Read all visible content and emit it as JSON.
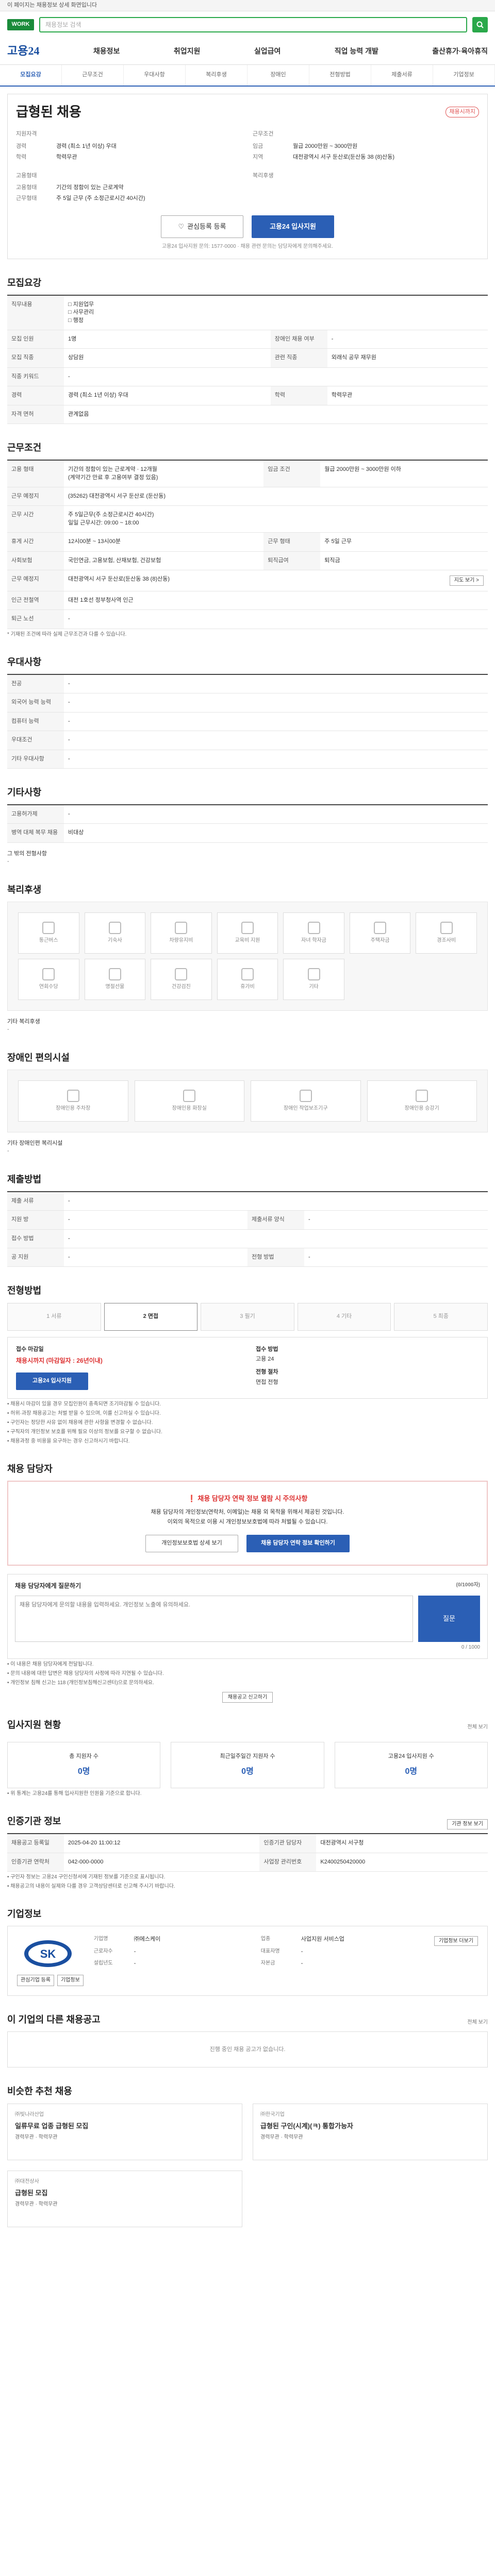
{
  "banner": {
    "text": "이 페이지는 채용정보 상세 화면입니다"
  },
  "search": {
    "placeholder": "채용정보 검색"
  },
  "gnb": {
    "brand": "고용24",
    "items": [
      "채용정보",
      "취업지원",
      "실업급여",
      "직업 능력 개발",
      "출산휴가·육아휴직"
    ]
  },
  "tabs": [
    "모집요강",
    "근무조건",
    "우대사항",
    "복리후생",
    "장애인",
    "전형방법",
    "제출서류",
    "기업정보"
  ],
  "job": {
    "badge": "채용시까지",
    "title": "급형된 채용",
    "left_heading": "지원자격",
    "left": [
      {
        "k": "경력",
        "v": "경력 (최소 1년 이상) 우대"
      },
      {
        "k": "학력",
        "v": "학력무관"
      }
    ],
    "right_heading": "근무조건",
    "right": [
      {
        "k": "임금",
        "v": "월급 2000만원 ~ 3000만원"
      },
      {
        "k": "지역",
        "v": "대전광역시 서구 둔산로(둔산동 38 (8)산동)"
      }
    ],
    "left2_heading": "고용형태",
    "left2": [
      {
        "k": "고용형태",
        "v": "기간의 정함이 있는 근로계약"
      },
      {
        "k": "근무형태",
        "v": "주 5일 근무 (주 소정근로시간 40시간)"
      }
    ],
    "right2_heading": "복리후생",
    "apply_buttons": {
      "bookmark": "관심등록 등록",
      "apply": "고용24 입사지원"
    },
    "note": "고용24 입사지원 문의: 1577-0000 · 채용 관련 문의는 담당자에게 문의해주세요."
  },
  "recruit": {
    "title": "모집요강",
    "rows": [
      {
        "k": "직무내용",
        "v": "□ 지원업무\n□ 사무관리\n□ 행정"
      },
      {
        "k": "모집 인원",
        "v": "1명"
      },
      {
        "k": "모집 직종",
        "v": "상담원"
      },
      {
        "k": "직종 키워드",
        "v": "-"
      },
      {
        "k": "경력",
        "v": "경력 (최소 1년 이상) 우대"
      },
      {
        "k": "자격 면허",
        "v": "관계없음"
      }
    ],
    "rows_right": [
      {
        "k": "장애인 채용 여부",
        "v": "-"
      },
      {
        "k": "관련 직종",
        "v": "외래식 공무 재무원"
      },
      {
        "k": "학력",
        "v": "학력무관"
      }
    ]
  },
  "conditions": {
    "title": "근무조건",
    "rows": [
      {
        "k": "고용 형태",
        "v": "기간의 정함이 있는 근로계약 · 12개월\n(계약기간 만료 후 고용여부 결정 있음)"
      },
      {
        "k": "근무 예정지",
        "v": "(35262) 대전광역시 서구 둔산로 (둔산동)"
      },
      {
        "k": "근무 시간",
        "v": "주 5일근무(주 소정근로시간 40시간)\n일일 근무시간: 09:00 ~ 18:00"
      },
      {
        "k": "휴게 시간",
        "v": "12시00분 ~ 13시00분"
      },
      {
        "k": "사회보험",
        "v": "국민연금, 고용보험, 산재보험, 건강보험"
      },
      {
        "k": "근무 예정지",
        "v": "대전광역시 서구 둔산로(둔산동 38 (8)산동)"
      },
      {
        "k": "인근 전철역",
        "v": "대전 1호선 정부청사역 인근"
      },
      {
        "k": "퇴근 노선",
        "v": "-"
      }
    ],
    "right": [
      {
        "k": "임금 조건",
        "v": "월급 2000만원 ~ 3000만원 이하"
      },
      {
        "k": "근무 형태",
        "v": "주 5일 근무"
      },
      {
        "k": "퇴직급여",
        "v": "퇴직금"
      }
    ],
    "map_btn": "지도 보기 >",
    "footnote": "* 기재된 조건에 따라 실제 근무조건과 다를 수 있습니다."
  },
  "preference": {
    "title": "우대사항",
    "rows": [
      {
        "k": "전공",
        "v": "-"
      },
      {
        "k": "외국어 능력 능력",
        "v": "-"
      },
      {
        "k": "컴퓨터 능력",
        "v": "-"
      },
      {
        "k": "우대조건",
        "v": "-"
      },
      {
        "k": "기타 우대사항",
        "v": "-"
      }
    ]
  },
  "etc": {
    "title": "기타사항",
    "rows": [
      {
        "k": "고용허가제",
        "v": "-"
      },
      {
        "k": "병역 대체 복무 채용",
        "v": "비대상"
      }
    ],
    "extra_k": "그 밖의 전형사항",
    "extra_v": "-"
  },
  "welfare": {
    "title": "복리후생",
    "items": [
      "통근버스",
      "기숙사",
      "차량유지비",
      "교육비 지원",
      "자녀 학자금",
      "주택자금",
      "경조사비",
      "연회수당",
      "명절선물",
      "건강검진",
      "휴가비",
      "기타"
    ],
    "extra_k": "기타 복리후생",
    "extra_v": "-"
  },
  "disabled": {
    "title": "장애인 편의시설",
    "items": [
      "장애인용 주차장",
      "장애인용 화장실",
      "장애인 작업보조기구",
      "장애인용 승강기"
    ],
    "extra_k": "기타 장애인편 복리시설",
    "extra_v": "-"
  },
  "apply_info": {
    "title": "제출방법",
    "rows": [
      {
        "k": "제출 서류",
        "v": "-"
      },
      {
        "k": "지원 방",
        "v": "-"
      },
      {
        "k": "접수 방법",
        "v": "-"
      },
      {
        "k": "공 지원",
        "v": "-"
      }
    ],
    "right": [
      {
        "k": "제출서류 양식",
        "v": "-"
      },
      {
        "k": "전형 방법",
        "v": "-"
      }
    ]
  },
  "process": {
    "title": "전형방법",
    "steps": [
      "1 서류",
      "2 면접",
      "3 필기",
      "4 기타",
      "5 최종"
    ],
    "active": 1,
    "deadline_label": "접수 마감일",
    "deadline": "채용시까지 (마감일자 : 26년이내)",
    "apply_label": "고용24 입사지원",
    "method_label": "접수 방법",
    "method": "고용 24",
    "stage_label": "전형 절차",
    "stage": "면접 전형",
    "notes": [
      "• 채용시 마감이 있을 경우 모집인원이 충족되면 조기마감될 수 있습니다.",
      "• 허위·과장 채용공고는 처벌 받을 수 있으며, 이를 신고하실 수 있습니다.",
      "• 구인자는 정당한 사유 없이 채용에 관한 사항을 변경할 수 없습니다.",
      "• 구직자의 개인정보 보호를 위해 필요 이상의 정보를 요구할 수 없습니다.",
      "• 채용과정 중 비용을 요구하는 경우 신고하시기 바랍니다."
    ]
  },
  "contact": {
    "title": "채용 담당자",
    "alert": "채용 담당자 연락 정보 열람 시 주의사항",
    "body1": "채용 담당자의 개인정보(연락처, 이메일)는 채용 외 목적을 위해서 제공된 것입니다.",
    "body2": "이외의 목적으로 이용 시 개인정보보호법에 따라 처벌될 수 있습니다.",
    "btn1": "개인정보보호법 상세 보기",
    "btn2": "채용 담당자 연락 정보 확인하기",
    "q_title": "채용 담당자에게 질문하기",
    "q_hint": "(0/1000자)",
    "q_placeholder": "채용 담당자에게 문의할 내용을 입력하세요. 개인정보 노출에 유의하세요.",
    "q_count": "0 / 1000",
    "q_btn": "질문",
    "notes": [
      "• 이 내용은 채용 담당자에게 전달됩니다.",
      "• 문의 내용에 대한 답변은 채용 담당자의 사정에 따라 지연될 수 있습니다.",
      "• 개인정보 침해 신고는 118 (개인정보침해신고센터)으로 문의하세요."
    ],
    "report_btn": "채용공고 신고하기"
  },
  "apply_status": {
    "title": "입사지원 현황",
    "more": "전체 보기",
    "stats": [
      {
        "label": "총 지원자 수",
        "value": "0명"
      },
      {
        "label": "최근일주일간 지원자 수",
        "value": "0명"
      },
      {
        "label": "고용24 입사지원 수",
        "value": "0명"
      }
    ],
    "note": "• 위 통계는 고용24를 통해 입사지원한 인원을 기준으로 합니다."
  },
  "org": {
    "title": "인증기관 정보",
    "more": "기관 정보 보기",
    "rows": [
      {
        "k": "채용공고 등록일",
        "v": "2025-04-20 11:00:12"
      },
      {
        "k": "인증기관 담당자",
        "v": "대전광역시 서구청"
      },
      {
        "k": "인증기관 연락처",
        "v": "042-000-0000"
      },
      {
        "k": "사업장 관리번호",
        "v": "K2400250420000"
      }
    ],
    "notes": [
      "• 구인자 정보는 고용24 구인신청서에 기재된 정보를 기준으로 표시됩니다.",
      "• 채용공고의 내용이 실제와 다를 경우 고객상담센터로 신고해 주시기 바랍니다."
    ]
  },
  "company": {
    "title": "기업정보",
    "logo": "SK",
    "btns": [
      "관심기업 등록",
      "기업정보"
    ],
    "rows": [
      {
        "k": "기업명",
        "v": "㈜에스케이"
      },
      {
        "k": "업종",
        "v": "사업지원 서비스업"
      },
      {
        "k": "근로자수",
        "v": "-"
      },
      {
        "k": "대표자명",
        "v": "-"
      },
      {
        "k": "설립년도",
        "v": "-"
      },
      {
        "k": "자본금",
        "v": "-"
      }
    ],
    "more_btn": "기업정보 더보기"
  },
  "same_company": {
    "title": "이 기업의 다른 채용공고",
    "more": "전체 보기",
    "empty": "진행 중인 채용 공고가 없습니다."
  },
  "recommend": {
    "title": "비슷한 추천 채용",
    "items": [
      {
        "co": "㈜빛나라산업",
        "title": "일류무료 업종 급형된 모집",
        "ex": "경력무관 · 학력무관"
      },
      {
        "co": "㈜한국기업",
        "title": "급형된 구인(시계)(ㅋ) 통합가능자",
        "ex": "경력무관 · 학력무관"
      },
      {
        "co": "㈜대전상사",
        "title": "급형된 모집",
        "ex": "경력무관 · 학력무관"
      }
    ]
  },
  "colors": {
    "brand": "#2b5fb5",
    "search": "#2aa84a",
    "alert": "#d33"
  }
}
